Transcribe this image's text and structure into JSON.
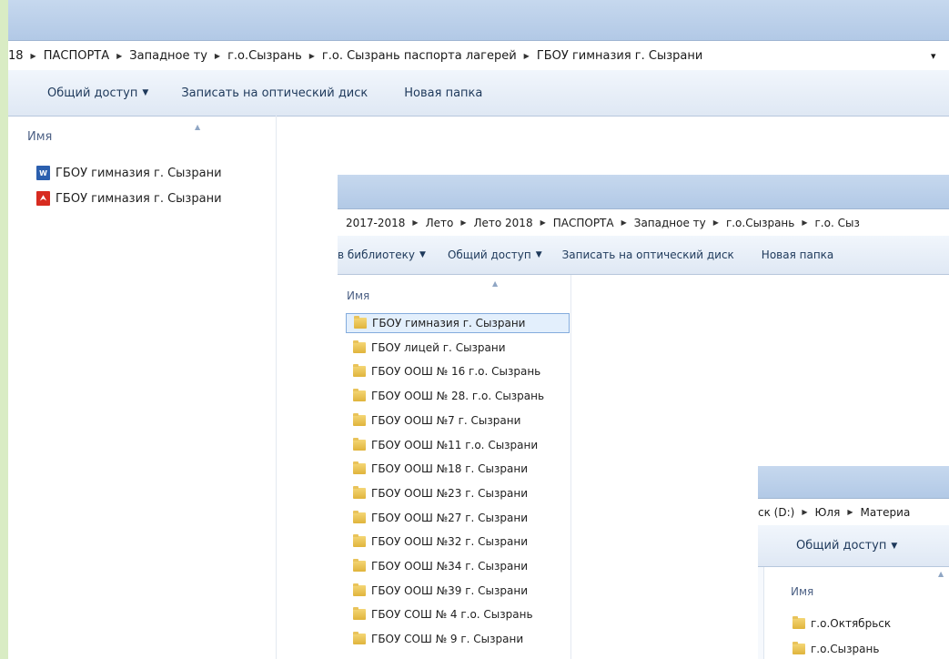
{
  "window1": {
    "breadcrumb": [
      "18",
      "ПАСПОРТА",
      "Западное ту",
      "г.о.Сызрань",
      "г.о. Сызрань паспорта лагерей",
      "ГБОУ гимназия г. Сызрани"
    ],
    "address_dropdown": "▾",
    "toolbar": {
      "share": "Общий доступ",
      "burn": "Записать на оптический диск",
      "new_folder": "Новая папка"
    },
    "column_name": "Имя",
    "files": [
      {
        "name": "ГБОУ гимназия г. Сызрани",
        "icon": "word-doc-icon"
      },
      {
        "name": "ГБОУ гимназия г. Сызрани",
        "icon": "pdf-file-icon"
      }
    ]
  },
  "window2": {
    "breadcrumb": [
      "2017-2018",
      "Лето",
      "Лето 2018",
      "ПАСПОРТА",
      "Западное ту",
      "г.о.Сызрань",
      "г.о. Сыз"
    ],
    "toolbar": {
      "library": "в библиотеку",
      "share": "Общий доступ",
      "burn": "Записать на оптический диск",
      "new_folder": "Новая папка"
    },
    "column_name": "Имя",
    "folders": [
      "ГБОУ гимназия г. Сызрани",
      "ГБОУ лицей г. Сызрани",
      "ГБОУ ООШ № 16 г.о. Сызрань",
      "ГБОУ ООШ № 28. г.о. Сызрань",
      "ГБОУ ООШ №7 г. Сызрани",
      "ГБОУ ООШ №11 г.о. Сызрани",
      "ГБОУ ООШ №18 г. Сызрани",
      "ГБОУ ООШ №23 г. Сызрани",
      "ГБОУ ООШ №27 г. Сызрани",
      "ГБОУ ООШ №32 г. Сызрани",
      "ГБОУ ООШ №34 г. Сызрани",
      "ГБОУ ООШ №39 г. Сызрани",
      "ГБОУ СОШ № 4 г.о. Сызрань",
      "ГБОУ СОШ № 9 г. Сызрани"
    ]
  },
  "window3": {
    "breadcrumb": [
      "ск (D:)",
      "Юля",
      "Материа"
    ],
    "toolbar": {
      "share": "Общий доступ"
    },
    "column_name": "Имя",
    "folders": [
      "г.о.Октябрьск",
      "г.о.Сызрань"
    ]
  },
  "colors": {
    "background": "#d9ecc4",
    "titlebar": "#bcd0ea",
    "selection": "#e3effc"
  }
}
